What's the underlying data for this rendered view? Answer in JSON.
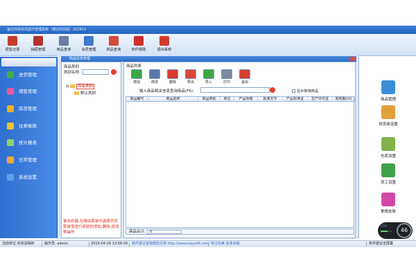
{
  "window": {
    "title": "速达商贸资讯提升管理系统（博达商贸版）2019V2"
  },
  "toolbar": [
    {
      "label": "便签记录",
      "icon": "notepad-icon",
      "color": "#c63b2d"
    },
    {
      "label": "抽屉管理",
      "icon": "drawer-icon",
      "color": "#b3322a"
    },
    {
      "label": "商品查询",
      "icon": "magnifier-icon",
      "color": "#6b7ea3"
    },
    {
      "label": "会员管理",
      "icon": "users-icon",
      "color": "#3f7acb"
    },
    {
      "label": "药品查询",
      "icon": "medicine-icon",
      "color": "#d6483a"
    },
    {
      "label": "软件帮助",
      "icon": "help-icon",
      "color": "#cf2e2e"
    },
    {
      "label": "退出系统",
      "icon": "power-icon",
      "color": "#cf3b2e"
    }
  ],
  "leftnav": [
    {
      "label": "进货管理",
      "icon": "plus-icon",
      "color": "#3db049"
    },
    {
      "label": "销售管理",
      "icon": "sales-icon",
      "color": "#e85a9a"
    },
    {
      "label": "库存管理",
      "icon": "star-icon",
      "color": "#f0b020"
    },
    {
      "label": "往来账款",
      "icon": "money-icon",
      "color": "#f2c330"
    },
    {
      "label": "统计报表",
      "icon": "chart-icon",
      "color": "#8ed16b"
    },
    {
      "label": "日常管理",
      "icon": "folder-icon",
      "color": "#f3a53a"
    },
    {
      "label": "系统设置",
      "icon": "globe-icon",
      "color": "#5aa6e8"
    }
  ],
  "product_window": {
    "title": "商品信息管理",
    "category_panel": {
      "caption": "商品类别",
      "name_label": "类别名称:",
      "name_value": "",
      "tree_root": "所有类别",
      "tree_child": "默认类别",
      "note": "单击右键,在弹出菜单中选择不同菜单项进行类别的添加,删除,修改等操作"
    },
    "product_panel": {
      "caption": "商品列表",
      "actions": [
        {
          "label": "增加",
          "icon": "add-icon",
          "color": "#3aa845"
        },
        {
          "label": "修改",
          "icon": "edit-icon",
          "color": "#5a78a8"
        },
        {
          "label": "删除",
          "icon": "delete-icon",
          "color": "#d63a2d"
        },
        {
          "label": "导出",
          "icon": "export-icon",
          "color": "#d8463a"
        },
        {
          "label": "导入",
          "icon": "import-icon",
          "color": "#3aa845"
        },
        {
          "label": "打印",
          "icon": "print-icon",
          "color": "#7b8aa0"
        },
        {
          "label": "退出",
          "icon": "exit-icon",
          "color": "#d6402f"
        }
      ],
      "search_label": "输入商品相关信息查询商品(F6):",
      "search_value": "",
      "show_disabled_label": "显示禁用商品",
      "columns": [
        "商品编号",
        "商品名称",
        "商品类别",
        "单位",
        "产品规格",
        "批准文号",
        "产品标准证",
        "生产许可证",
        "有效期(月)"
      ],
      "total_label": "商品合计:",
      "total_value": "0"
    }
  },
  "rightnav": [
    {
      "label": "商品管理",
      "icon": "computer-icon",
      "color": "#3a8fd6"
    },
    {
      "label": "供货商设置",
      "icon": "people-icon",
      "color": "#e0a03a"
    },
    {
      "label": "仓库设置",
      "icon": "warehouse-icon",
      "color": "#7fb24a"
    },
    {
      "label": "员工设置",
      "icon": "staff-icon",
      "color": "#3fa14a"
    },
    {
      "label": "更换皮肤",
      "icon": "skin-icon",
      "color": "#d24aa8"
    }
  ],
  "sys_widget": {
    "cpu_label": "CPU",
    "cpu_fraction": 0.6,
    "value": "46"
  },
  "statusbar": {
    "shop": "当前单位:农资进销存",
    "operator": "操作员: admin",
    "datetime": "2019-04-29 13:56:09",
    "site": "软件建议咨询帮助文档 http://www.eqysoft.com/",
    "slogan": "专注完美 追求卓越",
    "right": "软件建议全屏幕"
  }
}
